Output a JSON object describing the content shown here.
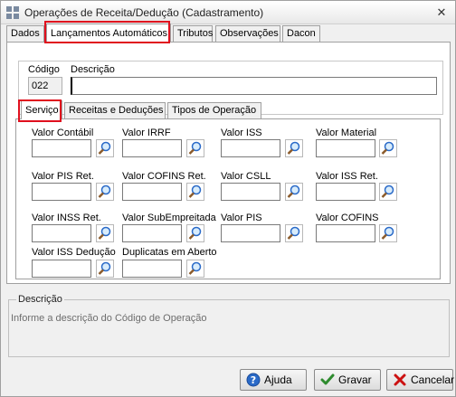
{
  "window": {
    "title": "Operações de Receita/Dedução (Cadastramento)",
    "close_label": "✕"
  },
  "tabs": [
    "Dados",
    "Lançamentos Automáticos",
    "Tributos",
    "Observações",
    "Dacon"
  ],
  "header": {
    "codigo_label": "Código",
    "codigo_value": "022",
    "descricao_label": "Descrição",
    "descricao_value": ""
  },
  "subtabs": [
    "Serviço",
    "Receitas e Deduções",
    "Tipos de Operação"
  ],
  "fields": [
    {
      "label": "Valor Contábil",
      "value": ""
    },
    {
      "label": "Valor IRRF",
      "value": ""
    },
    {
      "label": "Valor ISS",
      "value": ""
    },
    {
      "label": "Valor Material",
      "value": ""
    },
    {
      "label": "Valor PIS Ret.",
      "value": ""
    },
    {
      "label": "Valor COFINS Ret.",
      "value": ""
    },
    {
      "label": "Valor CSLL",
      "value": ""
    },
    {
      "label": "Valor ISS Ret.",
      "value": ""
    },
    {
      "label": "Valor INSS Ret.",
      "value": ""
    },
    {
      "label": "Valor SubEmpreitada",
      "value": ""
    },
    {
      "label": "Valor PIS",
      "value": ""
    },
    {
      "label": "Valor COFINS",
      "value": ""
    },
    {
      "label": "Valor ISS Dedução",
      "value": ""
    },
    {
      "label": "Duplicatas em Aberto",
      "value": ""
    }
  ],
  "description_box": {
    "title": "Descrição",
    "text": "Informe a descrição do Código de Operação"
  },
  "buttons": {
    "help": "Ajuda",
    "save": "Gravar",
    "cancel": "Cancelar"
  },
  "icons": {
    "app": "grid-icon",
    "search": "magnifier-icon",
    "help": "help-icon",
    "save": "checkmark-icon",
    "cancel": "x-mark-icon"
  },
  "colors": {
    "highlight": "#e0101e",
    "save_check": "#2e8b2e",
    "cancel_x": "#cc1111",
    "help_blue": "#2a6ac8"
  }
}
